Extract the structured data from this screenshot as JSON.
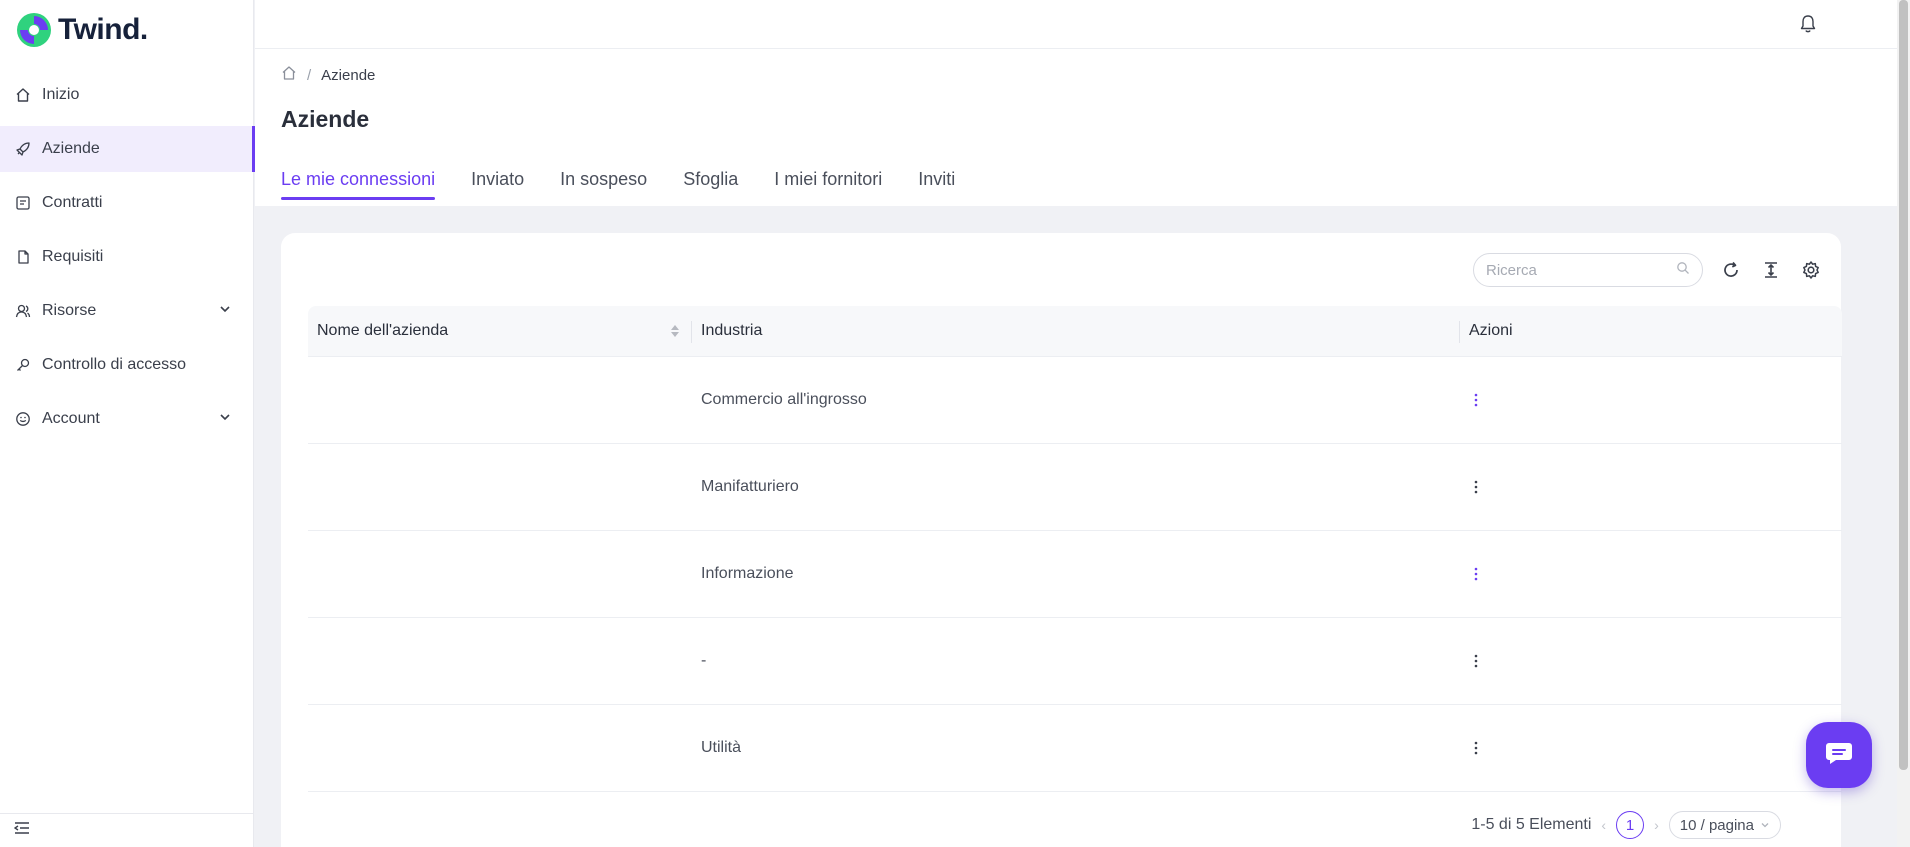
{
  "brand": {
    "name": "Twind.",
    "accent": "#6b3df2"
  },
  "sidebar": {
    "items": [
      {
        "label": "Inizio",
        "icon": "home-icon",
        "active": false
      },
      {
        "label": "Aziende",
        "icon": "rocket-icon",
        "active": true
      },
      {
        "label": "Contratti",
        "icon": "contract-icon",
        "active": false
      },
      {
        "label": "Requisiti",
        "icon": "document-icon",
        "active": false
      },
      {
        "label": "Risorse",
        "icon": "users-icon",
        "active": false,
        "expandable": true
      },
      {
        "label": "Controllo di accesso",
        "icon": "key-icon",
        "active": false
      },
      {
        "label": "Account",
        "icon": "smile-icon",
        "active": false,
        "expandable": true
      }
    ],
    "collapse_icon": "menu-collapse-icon"
  },
  "topbar": {
    "notification_icon": "bell-icon"
  },
  "breadcrumb": {
    "home_icon": "home-icon",
    "separator": "/",
    "current": "Aziende"
  },
  "page": {
    "title": "Aziende"
  },
  "tabs": [
    {
      "label": "Le mie connessioni",
      "active": true
    },
    {
      "label": "Inviato",
      "active": false
    },
    {
      "label": "In sospeso",
      "active": false
    },
    {
      "label": "Sfoglia",
      "active": false
    },
    {
      "label": "I miei fornitori",
      "active": false
    },
    {
      "label": "Inviti",
      "active": false
    }
  ],
  "search": {
    "placeholder": "Ricerca",
    "value": ""
  },
  "toolbar_icons": [
    "reload-icon",
    "column-height-icon",
    "settings-icon"
  ],
  "table": {
    "columns": [
      "Nome dell'azienda",
      "Industria",
      "Azioni"
    ],
    "rows": [
      {
        "name": "",
        "industry": "Commercio all'ingrosso"
      },
      {
        "name": "",
        "industry": "Manifatturiero"
      },
      {
        "name": "",
        "industry": "Informazione"
      },
      {
        "name": "",
        "industry": "-"
      },
      {
        "name": "",
        "industry": "Utilità"
      }
    ]
  },
  "pagination": {
    "summary": "1-5 di 5 Elementi",
    "current_page": "1",
    "page_size": "10 / pagina"
  }
}
